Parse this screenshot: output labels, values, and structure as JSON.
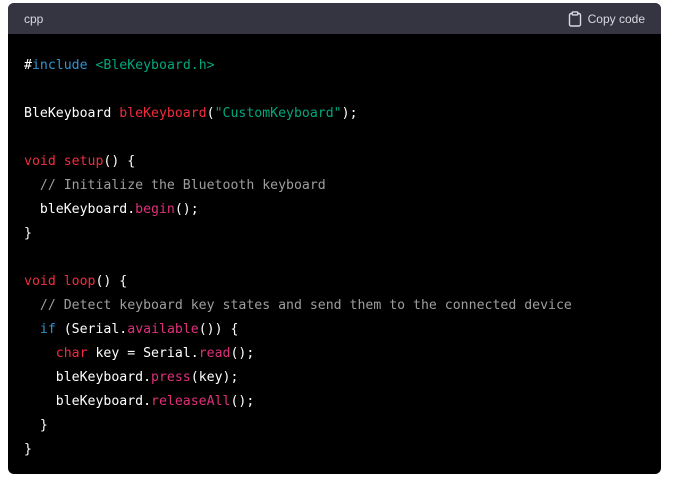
{
  "header": {
    "language": "cpp",
    "copy_label": "Copy code",
    "copy_icon": "clipboard-icon"
  },
  "colors": {
    "background": "#000000",
    "header_background": "#343541",
    "keyword": "#2e95d3",
    "function": "#f22c3d",
    "method": "#df3079",
    "string": "#00a67d",
    "comment": "#9e9e9e"
  },
  "code_lines": [
    [
      {
        "t": "#",
        "k": "plain"
      },
      {
        "t": "include",
        "k": "keyword"
      },
      {
        "t": " ",
        "k": "plain"
      },
      {
        "t": "<BleKeyboard.h>",
        "k": "include"
      }
    ],
    [],
    [
      {
        "t": "BleKeyboard ",
        "k": "plain"
      },
      {
        "t": "bleKeyboard",
        "k": "func"
      },
      {
        "t": "(",
        "k": "plain"
      },
      {
        "t": "\"CustomKeyboard\"",
        "k": "string"
      },
      {
        "t": ");",
        "k": "plain"
      }
    ],
    [],
    [
      {
        "t": "void",
        "k": "type"
      },
      {
        "t": " ",
        "k": "plain"
      },
      {
        "t": "setup",
        "k": "func"
      },
      {
        "t": "() {",
        "k": "plain"
      }
    ],
    [
      {
        "t": "  ",
        "k": "plain"
      },
      {
        "t": "// Initialize the Bluetooth keyboard",
        "k": "comment"
      }
    ],
    [
      {
        "t": "  bleKeyboard.",
        "k": "plain"
      },
      {
        "t": "begin",
        "k": "method"
      },
      {
        "t": "();",
        "k": "plain"
      }
    ],
    [
      {
        "t": "}",
        "k": "plain"
      }
    ],
    [],
    [
      {
        "t": "void",
        "k": "type"
      },
      {
        "t": " ",
        "k": "plain"
      },
      {
        "t": "loop",
        "k": "func"
      },
      {
        "t": "() {",
        "k": "plain"
      }
    ],
    [
      {
        "t": "  ",
        "k": "plain"
      },
      {
        "t": "// Detect keyboard key states and send them to the connected device",
        "k": "comment"
      }
    ],
    [
      {
        "t": "  ",
        "k": "plain"
      },
      {
        "t": "if",
        "k": "keyword"
      },
      {
        "t": " (Serial.",
        "k": "plain"
      },
      {
        "t": "available",
        "k": "method"
      },
      {
        "t": "()) {",
        "k": "plain"
      }
    ],
    [
      {
        "t": "    ",
        "k": "plain"
      },
      {
        "t": "char",
        "k": "type"
      },
      {
        "t": " key = Serial.",
        "k": "plain"
      },
      {
        "t": "read",
        "k": "method"
      },
      {
        "t": "();",
        "k": "plain"
      }
    ],
    [
      {
        "t": "    bleKeyboard.",
        "k": "plain"
      },
      {
        "t": "press",
        "k": "method"
      },
      {
        "t": "(key);",
        "k": "plain"
      }
    ],
    [
      {
        "t": "    bleKeyboard.",
        "k": "plain"
      },
      {
        "t": "releaseAll",
        "k": "method"
      },
      {
        "t": "();",
        "k": "plain"
      }
    ],
    [
      {
        "t": "  }",
        "k": "plain"
      }
    ],
    [
      {
        "t": "}",
        "k": "plain"
      }
    ]
  ]
}
